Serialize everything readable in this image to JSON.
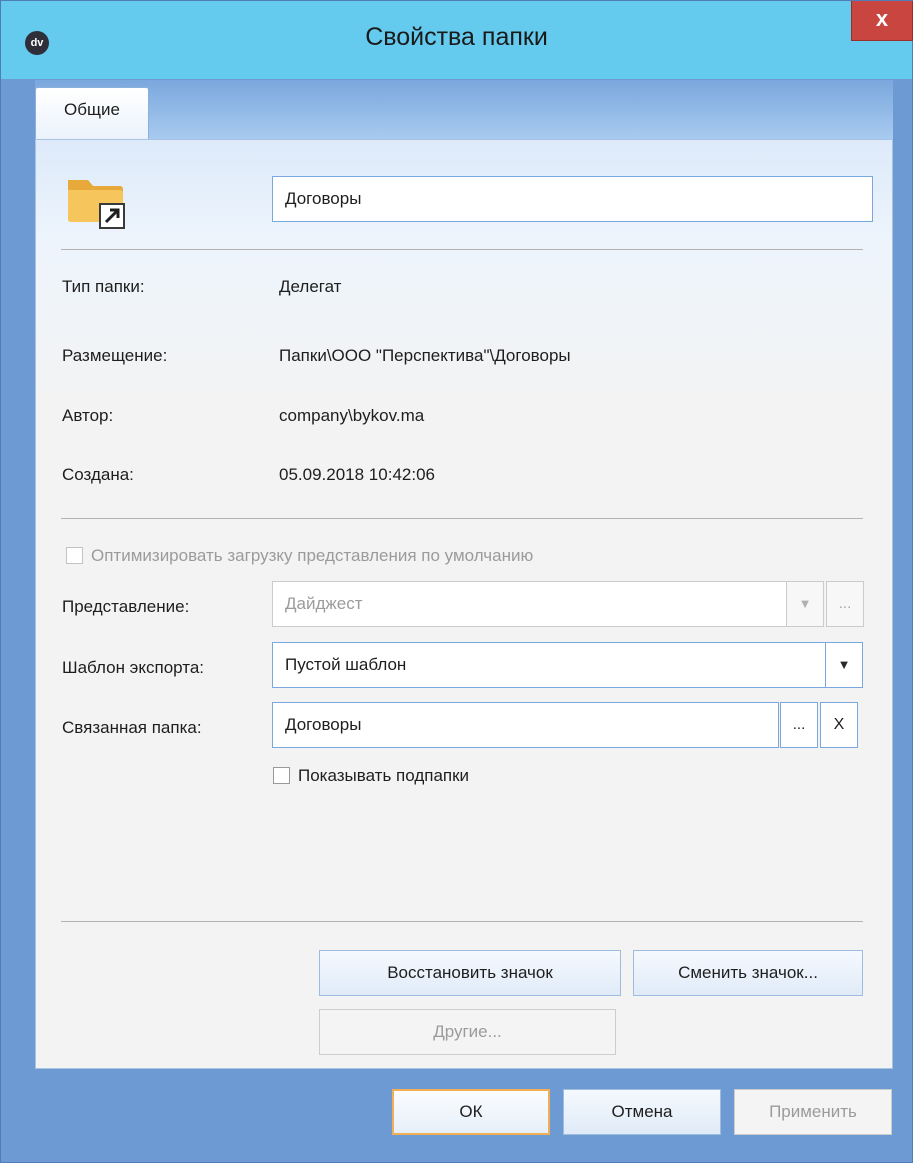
{
  "window": {
    "title": "Свойства папки",
    "app_logo_text": "dv",
    "close_label": "x"
  },
  "tabs": [
    {
      "label": "Общие",
      "active": true
    }
  ],
  "folder": {
    "icon": "folder-shortcut-icon",
    "name_value": "Договоры"
  },
  "info": {
    "type_label": "Тип папки:",
    "type_value": "Делегат",
    "location_label": "Размещение:",
    "location_value": "Папки\\ООО \"Перспектива\"\\Договоры",
    "author_label": "Автор:",
    "author_value": "company\\bykov.ma",
    "created_label": "Создана:",
    "created_value": "05.09.2018 10:42:06"
  },
  "options": {
    "optimize_label": "Оптимизировать загрузку представления по умолчанию",
    "optimize_checked": false,
    "view_label": "Представление:",
    "view_value": "Дайджест",
    "view_browse": "...",
    "export_label": "Шаблон экспорта:",
    "export_value": "Пустой шаблон",
    "linked_label": "Связанная папка:",
    "linked_value": "Договоры",
    "linked_browse": "...",
    "linked_clear": "X",
    "show_sub_label": "Показывать подпапки",
    "show_sub_checked": false
  },
  "icon_buttons": {
    "restore": "Восстановить значок",
    "change": "Сменить значок...",
    "other": "Другие..."
  },
  "dialog_buttons": {
    "ok": "ОК",
    "cancel": "Отмена",
    "apply": "Применить"
  },
  "colors": {
    "titlebar": "#64cbef",
    "frame": "#6d9ad2",
    "close": "#c8463f",
    "default_button_border": "#f1ae54"
  }
}
